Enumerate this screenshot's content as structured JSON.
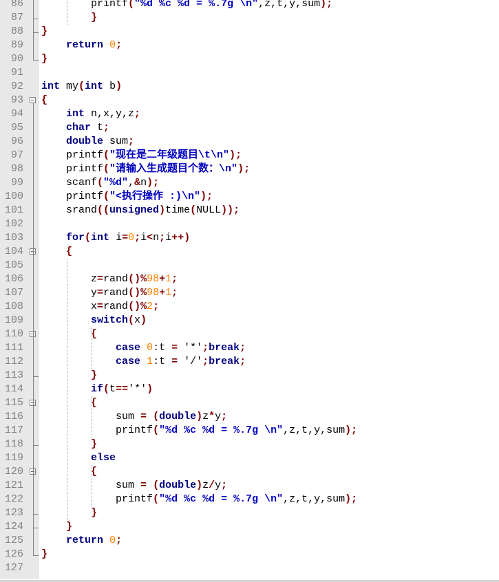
{
  "editor": {
    "lines": [
      {
        "n": "86",
        "fold": "",
        "code": [
          [
            "        ",
            "t"
          ],
          [
            "printf",
            "t"
          ],
          [
            "(",
            "p"
          ],
          [
            "\"%d %c %d = %.7g \\n\"",
            "s"
          ],
          [
            ",z,t,y,sum",
            "t"
          ],
          [
            ")",
            "p"
          ],
          [
            ";",
            "p"
          ]
        ]
      },
      {
        "n": "87",
        "fold": "end",
        "code": [
          [
            "        ",
            "t"
          ],
          [
            "}",
            "p"
          ]
        ]
      },
      {
        "n": "88",
        "fold": "end",
        "code": [
          [
            "}",
            "p"
          ]
        ]
      },
      {
        "n": "89",
        "fold": "",
        "code": [
          [
            "    ",
            "t"
          ],
          [
            "return",
            "k"
          ],
          [
            " ",
            "t"
          ],
          [
            "0",
            "n"
          ],
          [
            ";",
            "p"
          ]
        ]
      },
      {
        "n": "90",
        "fold": "end",
        "code": [
          [
            "}",
            "p"
          ]
        ]
      },
      {
        "n": "91",
        "fold": "",
        "code": []
      },
      {
        "n": "92",
        "fold": "",
        "code": [
          [
            "int",
            "k"
          ],
          [
            " my",
            "t"
          ],
          [
            "(",
            "p"
          ],
          [
            "int",
            "k"
          ],
          [
            " b",
            "t"
          ],
          [
            ")",
            "p"
          ]
        ]
      },
      {
        "n": "93",
        "fold": "box",
        "code": [
          [
            "{",
            "p"
          ]
        ]
      },
      {
        "n": "94",
        "fold": "",
        "code": [
          [
            "    ",
            "t"
          ],
          [
            "int",
            "k"
          ],
          [
            " n,x,y,z",
            "t"
          ],
          [
            ";",
            "p"
          ]
        ]
      },
      {
        "n": "95",
        "fold": "",
        "code": [
          [
            "    ",
            "t"
          ],
          [
            "char",
            "k"
          ],
          [
            " t",
            "t"
          ],
          [
            ";",
            "p"
          ]
        ]
      },
      {
        "n": "96",
        "fold": "",
        "code": [
          [
            "    ",
            "t"
          ],
          [
            "double",
            "k"
          ],
          [
            " sum",
            "t"
          ],
          [
            ";",
            "p"
          ]
        ]
      },
      {
        "n": "97",
        "fold": "",
        "code": [
          [
            "    ",
            "t"
          ],
          [
            "printf",
            "t"
          ],
          [
            "(",
            "p"
          ],
          [
            "\"现在是二年级题目\\t\\n\"",
            "s"
          ],
          [
            ")",
            "p"
          ],
          [
            ";",
            "p"
          ]
        ]
      },
      {
        "n": "98",
        "fold": "",
        "code": [
          [
            "    ",
            "t"
          ],
          [
            "printf",
            "t"
          ],
          [
            "(",
            "p"
          ],
          [
            "\"请输入生成题目个数：\\n\"",
            "s"
          ],
          [
            ")",
            "p"
          ],
          [
            ";",
            "p"
          ]
        ]
      },
      {
        "n": "99",
        "fold": "",
        "code": [
          [
            "    ",
            "t"
          ],
          [
            "scanf",
            "t"
          ],
          [
            "(",
            "p"
          ],
          [
            "\"%d\"",
            "s"
          ],
          [
            ",",
            "t"
          ],
          [
            "&",
            "o"
          ],
          [
            "n",
            "t"
          ],
          [
            ")",
            "p"
          ],
          [
            ";",
            "p"
          ]
        ]
      },
      {
        "n": "100",
        "fold": "",
        "code": [
          [
            "    ",
            "t"
          ],
          [
            "printf",
            "t"
          ],
          [
            "(",
            "p"
          ],
          [
            "\"<执行操作 :)\\n\"",
            "s"
          ],
          [
            ")",
            "p"
          ],
          [
            ";",
            "p"
          ]
        ]
      },
      {
        "n": "101",
        "fold": "",
        "code": [
          [
            "    ",
            "t"
          ],
          [
            "srand",
            "t"
          ],
          [
            "((",
            "p"
          ],
          [
            "unsigned",
            "k"
          ],
          [
            ")",
            "p"
          ],
          [
            "time",
            "t"
          ],
          [
            "(",
            "p"
          ],
          [
            "NULL",
            "t"
          ],
          [
            "))",
            "p"
          ],
          [
            ";",
            "p"
          ]
        ]
      },
      {
        "n": "102",
        "fold": "",
        "code": []
      },
      {
        "n": "103",
        "fold": "",
        "code": [
          [
            "    ",
            "t"
          ],
          [
            "for",
            "k"
          ],
          [
            "(",
            "p"
          ],
          [
            "int",
            "k"
          ],
          [
            " i",
            "t"
          ],
          [
            "=",
            "o"
          ],
          [
            "0",
            "n"
          ],
          [
            ";",
            "p"
          ],
          [
            "i",
            "t"
          ],
          [
            "<",
            "o"
          ],
          [
            "n",
            "t"
          ],
          [
            ";",
            "p"
          ],
          [
            "i",
            "t"
          ],
          [
            "++",
            "o"
          ],
          [
            ")",
            "p"
          ]
        ]
      },
      {
        "n": "104",
        "fold": "box",
        "code": [
          [
            "    ",
            "t"
          ],
          [
            "{",
            "p"
          ]
        ]
      },
      {
        "n": "105",
        "fold": "",
        "code": []
      },
      {
        "n": "106",
        "fold": "",
        "code": [
          [
            "        ",
            "t"
          ],
          [
            "z",
            "t"
          ],
          [
            "=",
            "o"
          ],
          [
            "rand",
            "t"
          ],
          [
            "()",
            "p"
          ],
          [
            "%",
            "o"
          ],
          [
            "98",
            "n"
          ],
          [
            "+",
            "o"
          ],
          [
            "1",
            "n"
          ],
          [
            ";",
            "p"
          ]
        ]
      },
      {
        "n": "107",
        "fold": "",
        "code": [
          [
            "        ",
            "t"
          ],
          [
            "y",
            "t"
          ],
          [
            "=",
            "o"
          ],
          [
            "rand",
            "t"
          ],
          [
            "()",
            "p"
          ],
          [
            "%",
            "o"
          ],
          [
            "98",
            "n"
          ],
          [
            "+",
            "o"
          ],
          [
            "1",
            "n"
          ],
          [
            ";",
            "p"
          ]
        ]
      },
      {
        "n": "108",
        "fold": "",
        "code": [
          [
            "        ",
            "t"
          ],
          [
            "x",
            "t"
          ],
          [
            "=",
            "o"
          ],
          [
            "rand",
            "t"
          ],
          [
            "()",
            "p"
          ],
          [
            "%",
            "o"
          ],
          [
            "2",
            "n"
          ],
          [
            ";",
            "p"
          ]
        ]
      },
      {
        "n": "109",
        "fold": "",
        "code": [
          [
            "        ",
            "t"
          ],
          [
            "switch",
            "k"
          ],
          [
            "(",
            "p"
          ],
          [
            "x",
            "t"
          ],
          [
            ")",
            "p"
          ]
        ]
      },
      {
        "n": "110",
        "fold": "box",
        "code": [
          [
            "        ",
            "t"
          ],
          [
            "{",
            "p"
          ]
        ]
      },
      {
        "n": "111",
        "fold": "",
        "code": [
          [
            "            ",
            "t"
          ],
          [
            "case",
            "k"
          ],
          [
            " ",
            "t"
          ],
          [
            "0",
            "n"
          ],
          [
            ":t ",
            "t"
          ],
          [
            "=",
            "o"
          ],
          [
            " ",
            "t"
          ],
          [
            "'*'",
            "t"
          ],
          [
            ";",
            "p"
          ],
          [
            "break",
            "k"
          ],
          [
            ";",
            "p"
          ]
        ]
      },
      {
        "n": "112",
        "fold": "",
        "code": [
          [
            "            ",
            "t"
          ],
          [
            "case",
            "k"
          ],
          [
            " ",
            "t"
          ],
          [
            "1",
            "n"
          ],
          [
            ":t ",
            "t"
          ],
          [
            "=",
            "o"
          ],
          [
            " ",
            "t"
          ],
          [
            "'/'",
            "t"
          ],
          [
            ";",
            "p"
          ],
          [
            "break",
            "k"
          ],
          [
            ";",
            "p"
          ]
        ]
      },
      {
        "n": "113",
        "fold": "end",
        "code": [
          [
            "        ",
            "t"
          ],
          [
            "}",
            "p"
          ]
        ]
      },
      {
        "n": "114",
        "fold": "",
        "code": [
          [
            "        ",
            "t"
          ],
          [
            "if",
            "k"
          ],
          [
            "(",
            "p"
          ],
          [
            "t",
            "t"
          ],
          [
            "==",
            "o"
          ],
          [
            "'*'",
            "t"
          ],
          [
            ")",
            "p"
          ]
        ]
      },
      {
        "n": "115",
        "fold": "box",
        "code": [
          [
            "        ",
            "t"
          ],
          [
            "{",
            "p"
          ]
        ]
      },
      {
        "n": "116",
        "fold": "",
        "code": [
          [
            "            ",
            "t"
          ],
          [
            "sum ",
            "t"
          ],
          [
            "=",
            "o"
          ],
          [
            " ",
            "t"
          ],
          [
            "(",
            "p"
          ],
          [
            "double",
            "k"
          ],
          [
            ")",
            "p"
          ],
          [
            "z",
            "t"
          ],
          [
            "*",
            "o"
          ],
          [
            "y",
            "t"
          ],
          [
            ";",
            "p"
          ]
        ]
      },
      {
        "n": "117",
        "fold": "",
        "code": [
          [
            "            ",
            "t"
          ],
          [
            "printf",
            "t"
          ],
          [
            "(",
            "p"
          ],
          [
            "\"%d %c %d = %.7g \\n\"",
            "s"
          ],
          [
            ",z,t,y,sum",
            "t"
          ],
          [
            ")",
            "p"
          ],
          [
            ";",
            "p"
          ]
        ]
      },
      {
        "n": "118",
        "fold": "end",
        "code": [
          [
            "        ",
            "t"
          ],
          [
            "}",
            "p"
          ]
        ]
      },
      {
        "n": "119",
        "fold": "",
        "code": [
          [
            "        ",
            "t"
          ],
          [
            "else",
            "k"
          ]
        ]
      },
      {
        "n": "120",
        "fold": "box",
        "code": [
          [
            "        ",
            "t"
          ],
          [
            "{",
            "p"
          ]
        ]
      },
      {
        "n": "121",
        "fold": "",
        "code": [
          [
            "            ",
            "t"
          ],
          [
            "sum ",
            "t"
          ],
          [
            "=",
            "o"
          ],
          [
            " ",
            "t"
          ],
          [
            "(",
            "p"
          ],
          [
            "double",
            "k"
          ],
          [
            ")",
            "p"
          ],
          [
            "z",
            "t"
          ],
          [
            "/",
            "o"
          ],
          [
            "y",
            "t"
          ],
          [
            ";",
            "p"
          ]
        ]
      },
      {
        "n": "122",
        "fold": "",
        "code": [
          [
            "            ",
            "t"
          ],
          [
            "printf",
            "t"
          ],
          [
            "(",
            "p"
          ],
          [
            "\"%d %c %d = %.7g \\n\"",
            "s"
          ],
          [
            ",z,t,y,sum",
            "t"
          ],
          [
            ")",
            "p"
          ],
          [
            ";",
            "p"
          ]
        ]
      },
      {
        "n": "123",
        "fold": "end",
        "code": [
          [
            "        ",
            "t"
          ],
          [
            "}",
            "p"
          ]
        ]
      },
      {
        "n": "124",
        "fold": "end",
        "code": [
          [
            "    ",
            "t"
          ],
          [
            "}",
            "p"
          ]
        ]
      },
      {
        "n": "125",
        "fold": "",
        "code": [
          [
            "    ",
            "t"
          ],
          [
            "return",
            "k"
          ],
          [
            " ",
            "t"
          ],
          [
            "0",
            "n"
          ],
          [
            ";",
            "p"
          ]
        ]
      },
      {
        "n": "126",
        "fold": "end",
        "code": [
          [
            "}",
            "p"
          ]
        ]
      },
      {
        "n": "127",
        "fold": "",
        "code": []
      }
    ]
  }
}
